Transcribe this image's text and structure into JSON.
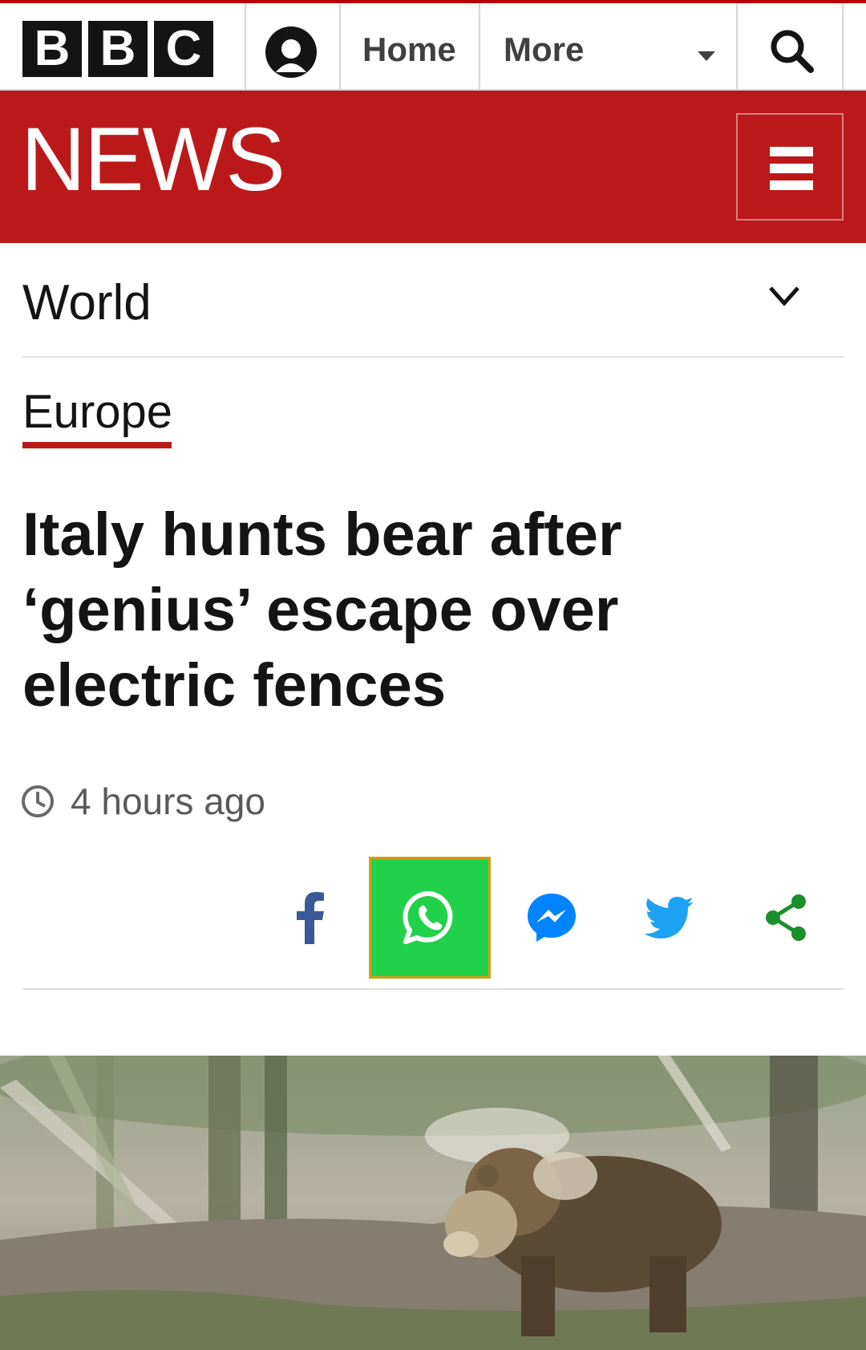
{
  "header": {
    "logo_letters": [
      "B",
      "B",
      "C"
    ],
    "nav": {
      "home": "Home",
      "more": "More"
    },
    "icons": [
      "account-icon",
      "dropdown-caret-icon",
      "search-icon"
    ]
  },
  "banner": {
    "wordmark": "NEWS",
    "menu_icon": "hamburger-menu-icon",
    "color": "#bb1919"
  },
  "section": {
    "title": "World",
    "subsection": "Europe"
  },
  "article": {
    "headline": "Italy hunts bear after ‘genius’ escape over electric fences",
    "timestamp": "4 hours ago"
  },
  "share": {
    "items": [
      "facebook-icon",
      "whatsapp-icon",
      "messenger-icon",
      "twitter-icon",
      "share-icon"
    ],
    "highlight_color": "#22d14a"
  },
  "image": {
    "subject": "bear-photo"
  }
}
